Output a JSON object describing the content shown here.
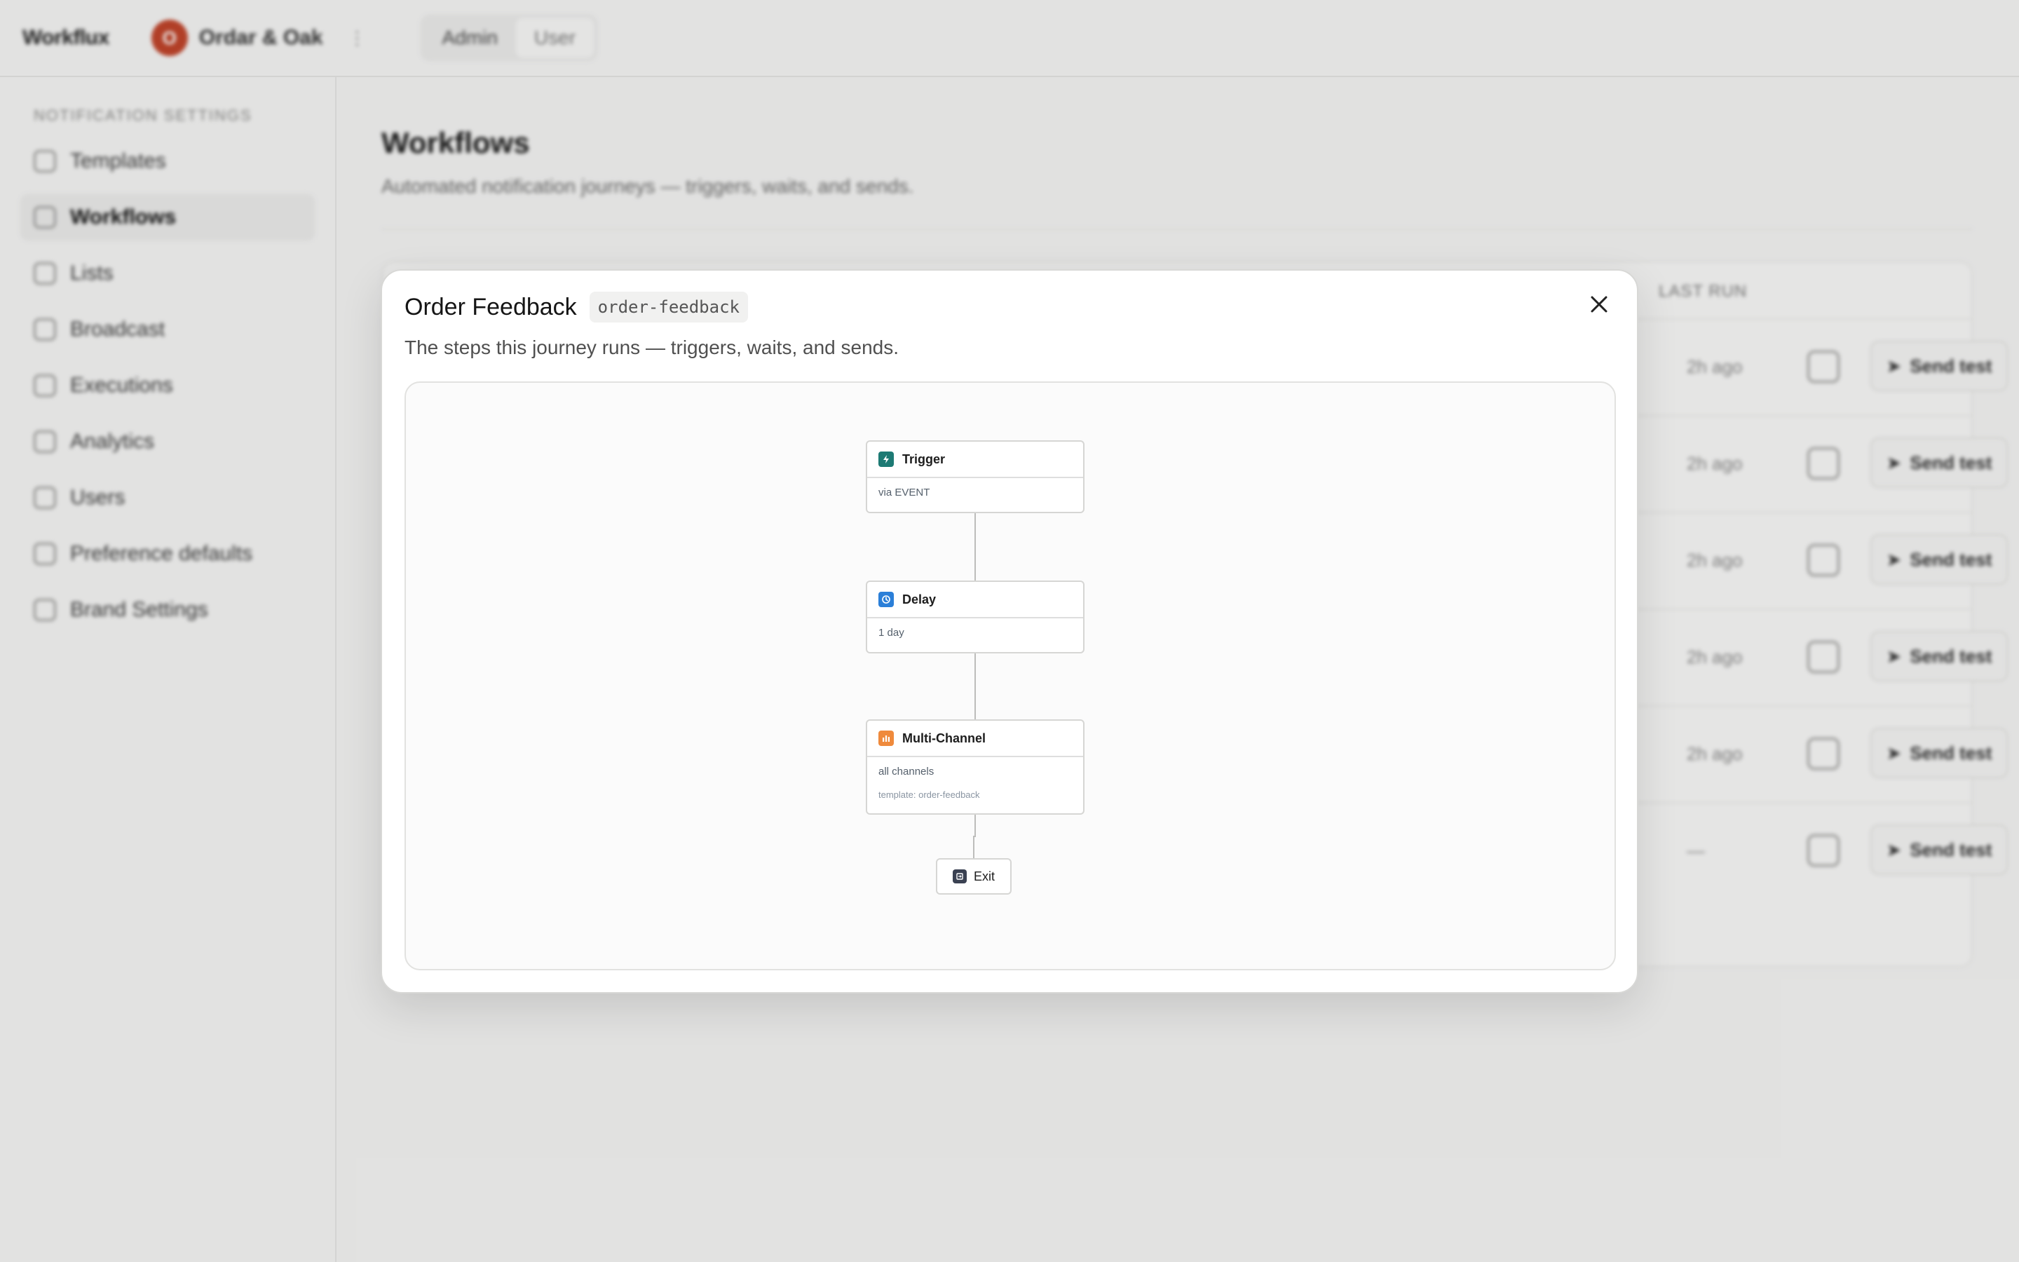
{
  "app": {
    "logo": "Workflux",
    "org": {
      "initial": "O",
      "name": "Ordar & Oak"
    },
    "env": {
      "admin_label": "Admin",
      "user_label": "User"
    }
  },
  "sidebar": {
    "section_label": "NOTIFICATION SETTINGS",
    "items": [
      {
        "label": "Templates",
        "icon": "template-icon"
      },
      {
        "label": "Workflows",
        "icon": "workflow-icon",
        "active": true
      },
      {
        "label": "Lists",
        "icon": "list-icon"
      },
      {
        "label": "Broadcast",
        "icon": "broadcast-icon"
      },
      {
        "label": "Executions",
        "icon": "execution-icon"
      },
      {
        "label": "Analytics",
        "icon": "analytics-icon"
      },
      {
        "label": "Users",
        "icon": "users-icon"
      },
      {
        "label": "Preference defaults",
        "icon": "preference-icon"
      },
      {
        "label": "Brand Settings",
        "icon": "brand-icon"
      }
    ]
  },
  "page": {
    "title": "Workflows",
    "subtitle": "Automated notification journeys — triggers, waits, and sends.",
    "last_run_header": "LAST RUN",
    "rows": [
      {
        "last_run": "2h ago",
        "send_label": "Send test"
      },
      {
        "last_run": "2h ago",
        "send_label": "Send test"
      },
      {
        "last_run": "2h ago",
        "send_label": "Send test"
      },
      {
        "last_run": "2h ago",
        "send_label": "Send test"
      },
      {
        "last_run": "2h ago",
        "send_label": "Send test"
      },
      {
        "last_run": "—",
        "send_label": "Send test"
      }
    ]
  },
  "modal": {
    "title": "Order Feedback",
    "slug": "order-feedback",
    "description": "The steps this journey runs — triggers, waits, and sends.",
    "close_icon": "close-icon",
    "steps": {
      "trigger": {
        "title": "Trigger",
        "detail": "via EVENT",
        "icon": "bolt-icon",
        "color": "#1d7a74"
      },
      "delay": {
        "title": "Delay",
        "detail": "1 day",
        "icon": "clock-icon",
        "color": "#2b7fd8"
      },
      "multichannel": {
        "title": "Multi-Channel",
        "detail": "all channels",
        "template": "template: order-feedback",
        "icon": "channels-icon",
        "color": "#ef8a3c"
      },
      "exit": {
        "title": "Exit",
        "icon": "exit-icon",
        "color": "#3a4152"
      }
    }
  }
}
